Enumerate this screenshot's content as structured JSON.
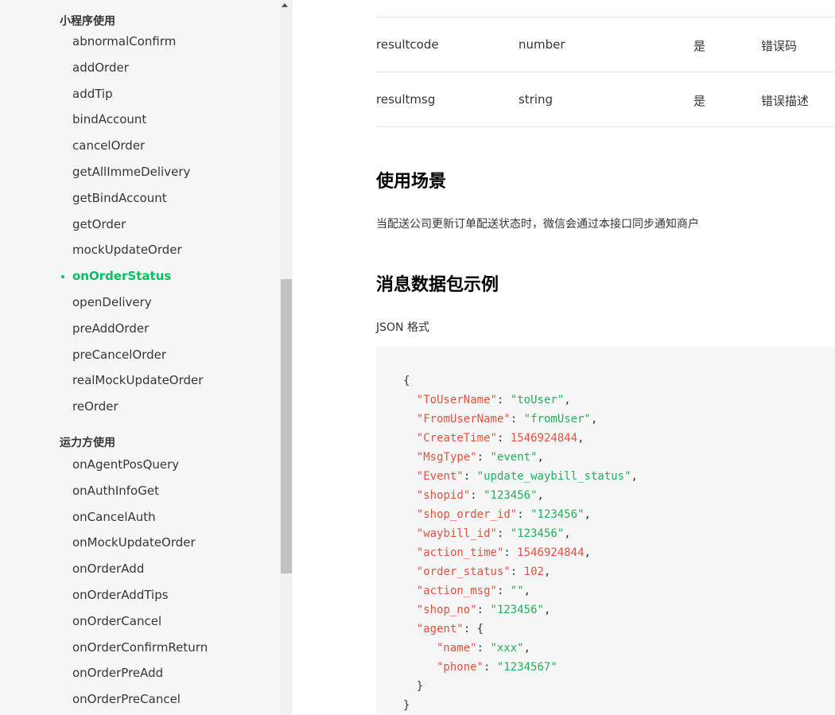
{
  "sidebar": {
    "group1_title": "小程序使用",
    "group1_items": [
      {
        "label": "abnormalConfirm"
      },
      {
        "label": "addOrder"
      },
      {
        "label": "addTip"
      },
      {
        "label": "bindAccount"
      },
      {
        "label": "cancelOrder"
      },
      {
        "label": "getAllImmeDelivery"
      },
      {
        "label": "getBindAccount"
      },
      {
        "label": "getOrder"
      },
      {
        "label": "mockUpdateOrder"
      },
      {
        "label": "onOrderStatus",
        "active": true
      },
      {
        "label": "openDelivery"
      },
      {
        "label": "preAddOrder"
      },
      {
        "label": "preCancelOrder"
      },
      {
        "label": "realMockUpdateOrder"
      },
      {
        "label": "reOrder"
      }
    ],
    "group2_title": "运力方使用",
    "group2_items": [
      {
        "label": "onAgentPosQuery"
      },
      {
        "label": "onAuthInfoGet"
      },
      {
        "label": "onCancelAuth"
      },
      {
        "label": "onMockUpdateOrder"
      },
      {
        "label": "onOrderAdd"
      },
      {
        "label": "onOrderAddTips"
      },
      {
        "label": "onOrderCancel"
      },
      {
        "label": "onOrderConfirmReturn"
      },
      {
        "label": "onOrderPreAdd"
      },
      {
        "label": "onOrderPreCancel"
      }
    ]
  },
  "params_table": {
    "rows": [
      {
        "name": "resultcode",
        "type": "number",
        "required": "是",
        "desc": "错误码"
      },
      {
        "name": "resultmsg",
        "type": "string",
        "required": "是",
        "desc": "错误描述"
      }
    ]
  },
  "usage": {
    "heading": "使用场景",
    "text": "当配送公司更新订单配送状态时，微信会通过本接口同步通知商户"
  },
  "example": {
    "heading": "消息数据包示例",
    "format_label": "JSON 格式",
    "json_fields": [
      {
        "key": "ToUserName",
        "value": "toUser",
        "kind": "string"
      },
      {
        "key": "FromUserName",
        "value": "fromUser",
        "kind": "string"
      },
      {
        "key": "CreateTime",
        "value": "1546924844",
        "kind": "number"
      },
      {
        "key": "MsgType",
        "value": "event",
        "kind": "string"
      },
      {
        "key": "Event",
        "value": "update_waybill_status",
        "kind": "string"
      },
      {
        "key": "shopid",
        "value": "123456",
        "kind": "string"
      },
      {
        "key": "shop_order_id",
        "value": "123456",
        "kind": "string"
      },
      {
        "key": "waybill_id",
        "value": "123456",
        "kind": "string"
      },
      {
        "key": "action_time",
        "value": "1546924844",
        "kind": "number"
      },
      {
        "key": "order_status",
        "value": "102",
        "kind": "number"
      },
      {
        "key": "action_msg",
        "value": "",
        "kind": "string"
      },
      {
        "key": "shop_no",
        "value": "123456",
        "kind": "string"
      }
    ],
    "agent_key": "agent",
    "agent_fields": [
      {
        "key": "name",
        "value": "xxx",
        "kind": "string"
      },
      {
        "key": "phone",
        "value": "1234567",
        "kind": "string"
      }
    ]
  }
}
